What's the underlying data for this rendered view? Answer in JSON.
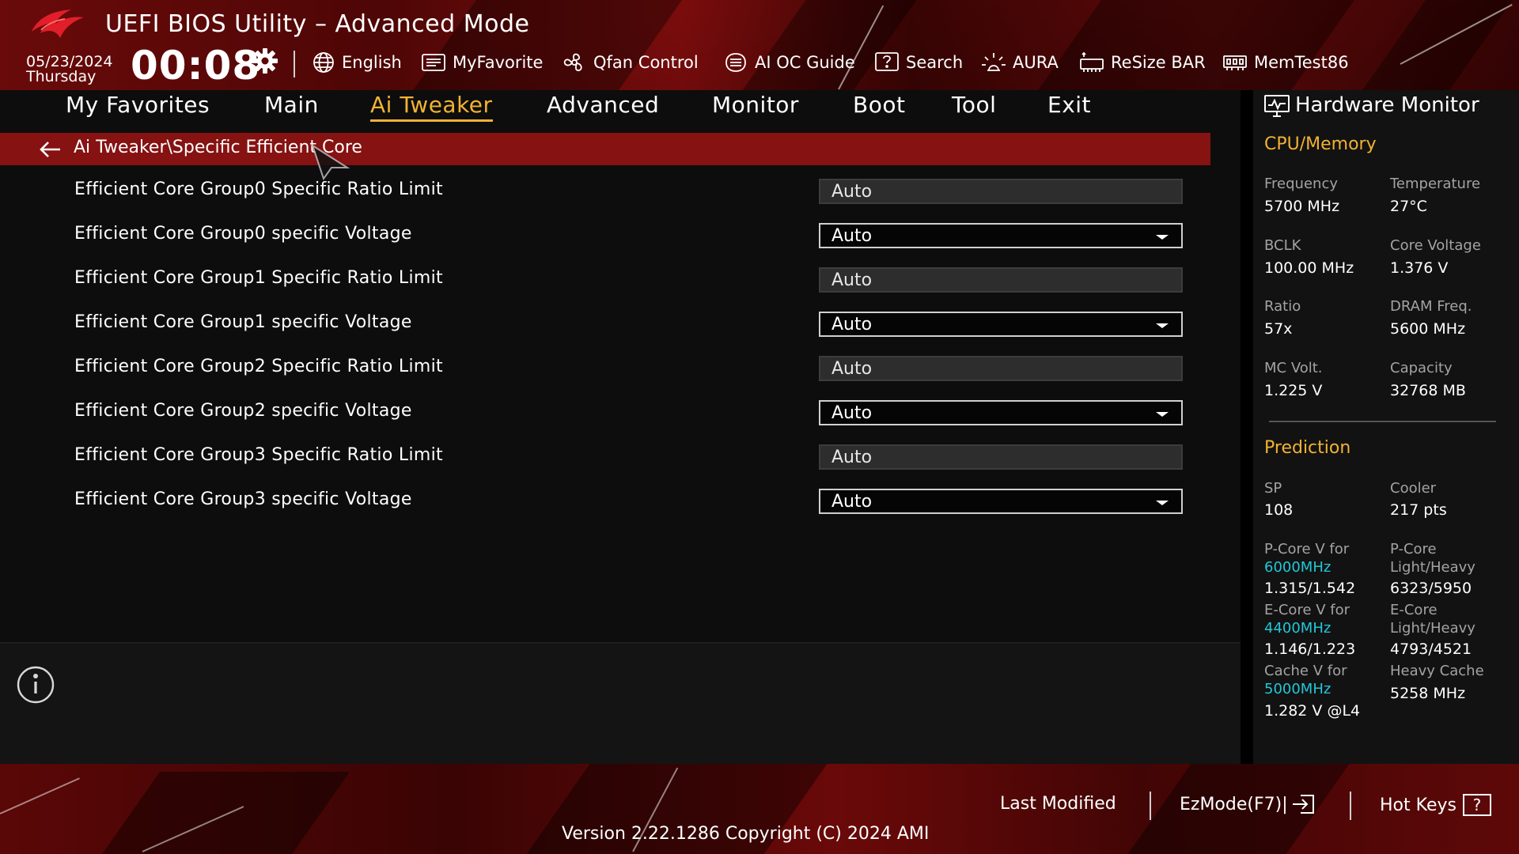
{
  "header": {
    "title": "UEFI BIOS Utility – Advanced Mode",
    "date": "05/23/2024",
    "weekday": "Thursday",
    "time": "00:08",
    "toolbar": [
      {
        "label": "English",
        "icon": "globe-icon"
      },
      {
        "label": "MyFavorite",
        "icon": "favorite-list-icon"
      },
      {
        "label": "Qfan Control",
        "icon": "fan-icon"
      },
      {
        "label": "AI OC Guide",
        "icon": "ai-chip-icon"
      },
      {
        "label": "Search",
        "icon": "search-help-icon"
      },
      {
        "label": "AURA",
        "icon": "aura-light-icon"
      },
      {
        "label": "ReSize BAR",
        "icon": "resize-bar-icon"
      },
      {
        "label": "MemTest86",
        "icon": "memory-icon"
      }
    ]
  },
  "nav": {
    "tabs": [
      "My Favorites",
      "Main",
      "Ai Tweaker",
      "Advanced",
      "Monitor",
      "Boot",
      "Tool",
      "Exit"
    ],
    "active": "Ai Tweaker"
  },
  "breadcrumb": "Ai Tweaker\\Specific Efficient Core",
  "settings": [
    {
      "label": "Efficient Core Group0 Specific Ratio Limit",
      "value": "Auto",
      "type": "readonly"
    },
    {
      "label": "Efficient Core Group0 specific Voltage",
      "value": "Auto",
      "type": "dropdown"
    },
    {
      "label": "Efficient Core Group1 Specific Ratio Limit",
      "value": "Auto",
      "type": "readonly"
    },
    {
      "label": "Efficient Core Group1 specific Voltage",
      "value": "Auto",
      "type": "dropdown"
    },
    {
      "label": "Efficient Core Group2 Specific Ratio Limit",
      "value": "Auto",
      "type": "readonly"
    },
    {
      "label": "Efficient Core Group2 specific Voltage",
      "value": "Auto",
      "type": "dropdown"
    },
    {
      "label": "Efficient Core Group3 Specific Ratio Limit",
      "value": "Auto",
      "type": "readonly"
    },
    {
      "label": "Efficient Core Group3 specific Voltage",
      "value": "Auto",
      "type": "dropdown"
    }
  ],
  "hardware_monitor": {
    "title": "Hardware Monitor",
    "cpu_memory": {
      "heading": "CPU/Memory",
      "items": [
        {
          "label": "Frequency",
          "value": "5700 MHz"
        },
        {
          "label": "Temperature",
          "value": "27°C"
        },
        {
          "label": "BCLK",
          "value": "100.00 MHz"
        },
        {
          "label": "Core Voltage",
          "value": "1.376 V"
        },
        {
          "label": "Ratio",
          "value": "57x"
        },
        {
          "label": "DRAM Freq.",
          "value": "5600 MHz"
        },
        {
          "label": "MC Volt.",
          "value": "1.225 V"
        },
        {
          "label": "Capacity",
          "value": "32768 MB"
        }
      ]
    },
    "prediction": {
      "heading": "Prediction",
      "sp_label": "SP",
      "sp_value": "108",
      "cooler_label": "Cooler",
      "cooler_value": "217 pts",
      "pcore_v_label": "P-Core V for",
      "pcore_v_freq": "6000MHz",
      "pcore_v_value": "1.315/1.542",
      "pcore_lh_label1": "P-Core",
      "pcore_lh_label2": "Light/Heavy",
      "pcore_lh_value": "6323/5950",
      "ecore_v_label": "E-Core V for",
      "ecore_v_freq": "4400MHz",
      "ecore_v_value": "1.146/1.223",
      "ecore_lh_label1": "E-Core",
      "ecore_lh_label2": "Light/Heavy",
      "ecore_lh_value": "4793/4521",
      "cache_v_label": "Cache V for",
      "cache_v_freq": "5000MHz",
      "cache_v_value": "1.282 V @L4",
      "heavy_cache_label": "Heavy Cache",
      "heavy_cache_value": "5258 MHz"
    }
  },
  "footer": {
    "last_modified": "Last Modified",
    "ezmode": "EzMode(F7)|",
    "hotkeys": "Hot Keys",
    "hotkeys_glyph": "?",
    "version": "Version 2.22.1286 Copyright (C) 2024 AMI"
  },
  "colors": {
    "accent_gold": "#f2b233",
    "breadcrumb_red": "#861212",
    "freq_cyan": "#22c7d9"
  }
}
